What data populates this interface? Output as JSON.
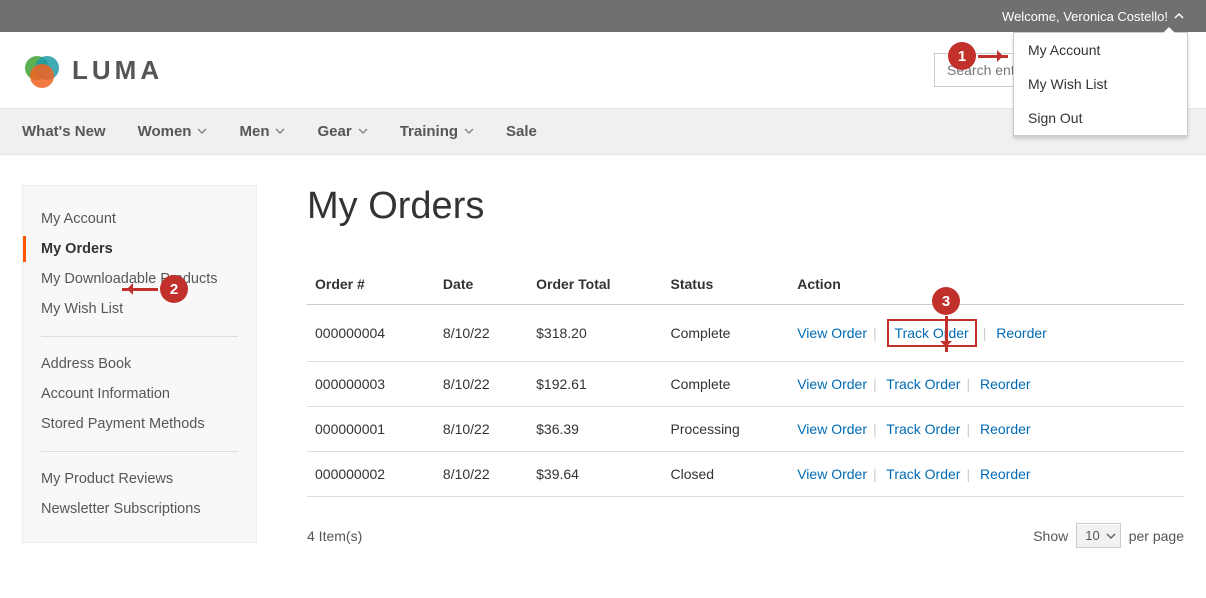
{
  "topbar": {
    "welcome": "Welcome, Veronica Costello!"
  },
  "dropdown": {
    "items": [
      "My Account",
      "My Wish List",
      "Sign Out"
    ]
  },
  "logo": {
    "text": "LUMA"
  },
  "search": {
    "placeholder": "Search entire st"
  },
  "nav": {
    "items": [
      {
        "label": "What's New",
        "sub": false
      },
      {
        "label": "Women",
        "sub": true
      },
      {
        "label": "Men",
        "sub": true
      },
      {
        "label": "Gear",
        "sub": true
      },
      {
        "label": "Training",
        "sub": true
      },
      {
        "label": "Sale",
        "sub": false
      }
    ]
  },
  "sidebar": {
    "g1": [
      "My Account",
      "My Orders",
      "My Downloadable Products",
      "My Wish List"
    ],
    "g2": [
      "Address Book",
      "Account Information",
      "Stored Payment Methods"
    ],
    "g3": [
      "My Product Reviews",
      "Newsletter Subscriptions"
    ]
  },
  "page": {
    "title": "My Orders"
  },
  "table": {
    "headers": [
      "Order #",
      "Date",
      "Order Total",
      "Status",
      "Action"
    ],
    "rows": [
      {
        "num": "000000004",
        "date": "8/10/22",
        "total": "$318.20",
        "status": "Complete"
      },
      {
        "num": "000000003",
        "date": "8/10/22",
        "total": "$192.61",
        "status": "Complete"
      },
      {
        "num": "000000001",
        "date": "8/10/22",
        "total": "$36.39",
        "status": "Processing"
      },
      {
        "num": "000000002",
        "date": "8/10/22",
        "total": "$39.64",
        "status": "Closed"
      }
    ],
    "actions": {
      "view": "View Order",
      "track": "Track Order",
      "reorder": "Reorder"
    }
  },
  "pager": {
    "count": "4 Item(s)",
    "show": "Show",
    "per": "per page",
    "value": "10"
  },
  "annotations": {
    "a1": "1",
    "a2": "2",
    "a3": "3"
  }
}
